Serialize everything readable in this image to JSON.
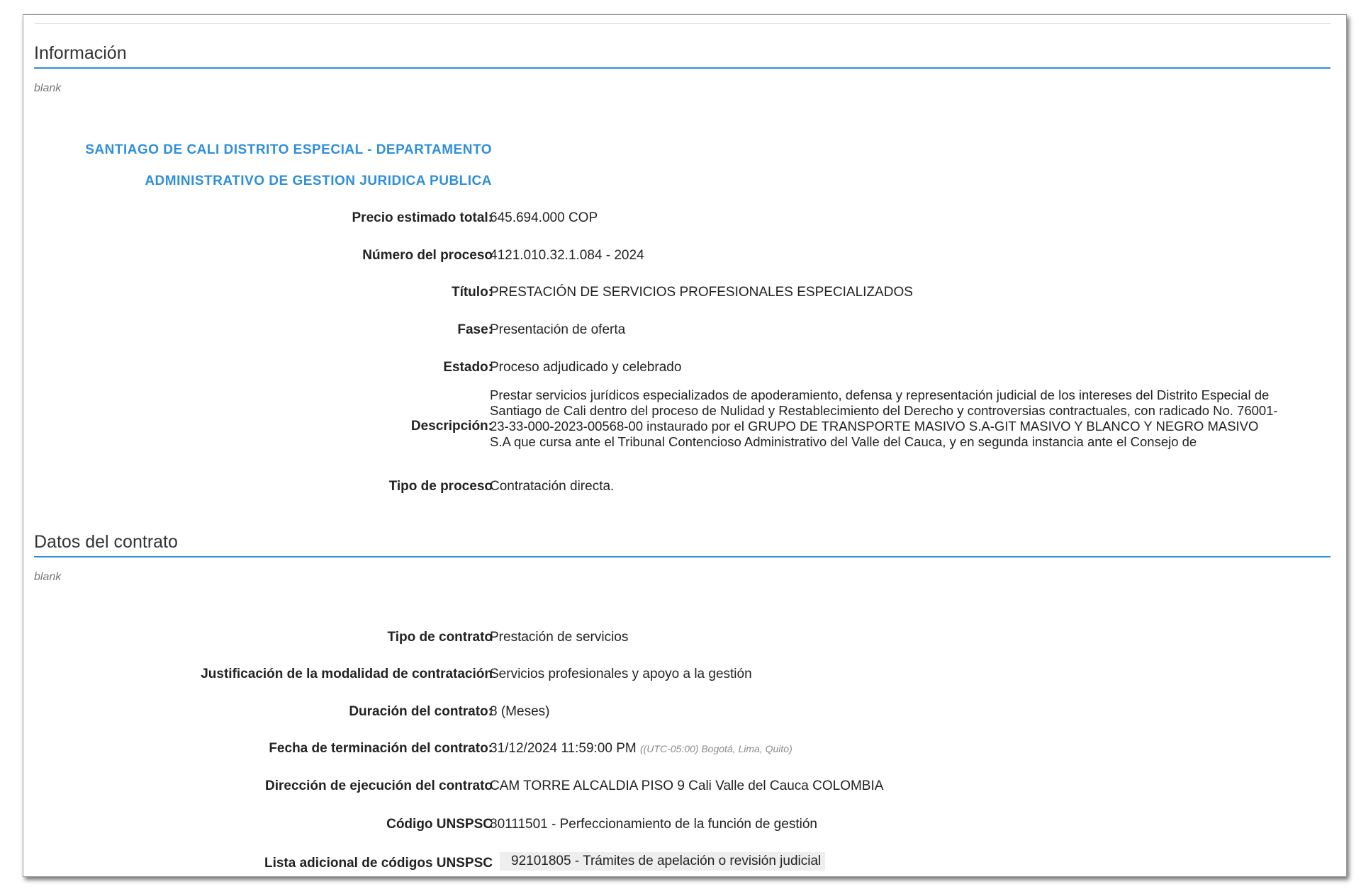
{
  "info": {
    "title": "Información",
    "blank": "blank",
    "entity_line1": "SANTIAGO DE CALI DISTRITO ESPECIAL - DEPARTAMENTO",
    "entity_line2": "ADMINISTRATIVO DE GESTION JURIDICA PUBLICA",
    "rows": [
      {
        "label": "Precio estimado total:",
        "value": "645.694.000 COP"
      },
      {
        "label": "Número del proceso",
        "value": "4121.010.32.1.084 - 2024"
      },
      {
        "label": "Título:",
        "value": "PRESTACIÓN DE SERVICIOS PROFESIONALES ESPECIALIZADOS"
      },
      {
        "label": "Fase:",
        "value": "Presentación de oferta"
      },
      {
        "label": "Estado:",
        "value": "Proceso adjudicado y celebrado"
      },
      {
        "label": "Descripción:",
        "value": "Prestar servicios jurídicos especializados de apoderamiento, defensa y representación judicial de los intereses del Distrito Especial de Santiago de Cali dentro del proceso de Nulidad y Restablecimiento del Derecho y controversias contractuales, con radicado No. 76001-23-33-000-2023-00568-00 instaurado por el GRUPO DE TRANSPORTE MASIVO S.A-GIT MASIVO Y BLANCO Y NEGRO MASIVO S.A que cursa ante el Tribunal Contencioso Administrativo del Valle del Cauca, y en segunda instancia ante el Consejo de"
      },
      {
        "label": "Tipo de proceso",
        "value": "Contratación directa."
      }
    ]
  },
  "contract": {
    "title": "Datos del contrato",
    "blank": "blank",
    "rows": [
      {
        "label": "Tipo de contrato",
        "value": "Prestación de servicios"
      },
      {
        "label": "Justificación de la modalidad de contratación",
        "value": "Servicios profesionales y apoyo a la gestión"
      },
      {
        "label": "Duración del contrato:",
        "value": "8 (Meses)"
      },
      {
        "label": "Fecha de terminación del contrato:",
        "value": "31/12/2024 11:59:00 PM",
        "timezone": "((UTC-05:00) Bogotá, Lima, Quito)"
      },
      {
        "label": "Dirección de ejecución del contrato",
        "value": "CAM TORRE ALCALDIA PISO 9 Cali Valle del Cauca COLOMBIA"
      },
      {
        "label": "Código UNSPSC",
        "value": "80111501 - Perfeccionamiento de la función de gestión"
      },
      {
        "label": "Lista adicional de códigos UNSPSC",
        "value": "92101805 - Trámites de apelación o revisión judicial"
      }
    ]
  }
}
